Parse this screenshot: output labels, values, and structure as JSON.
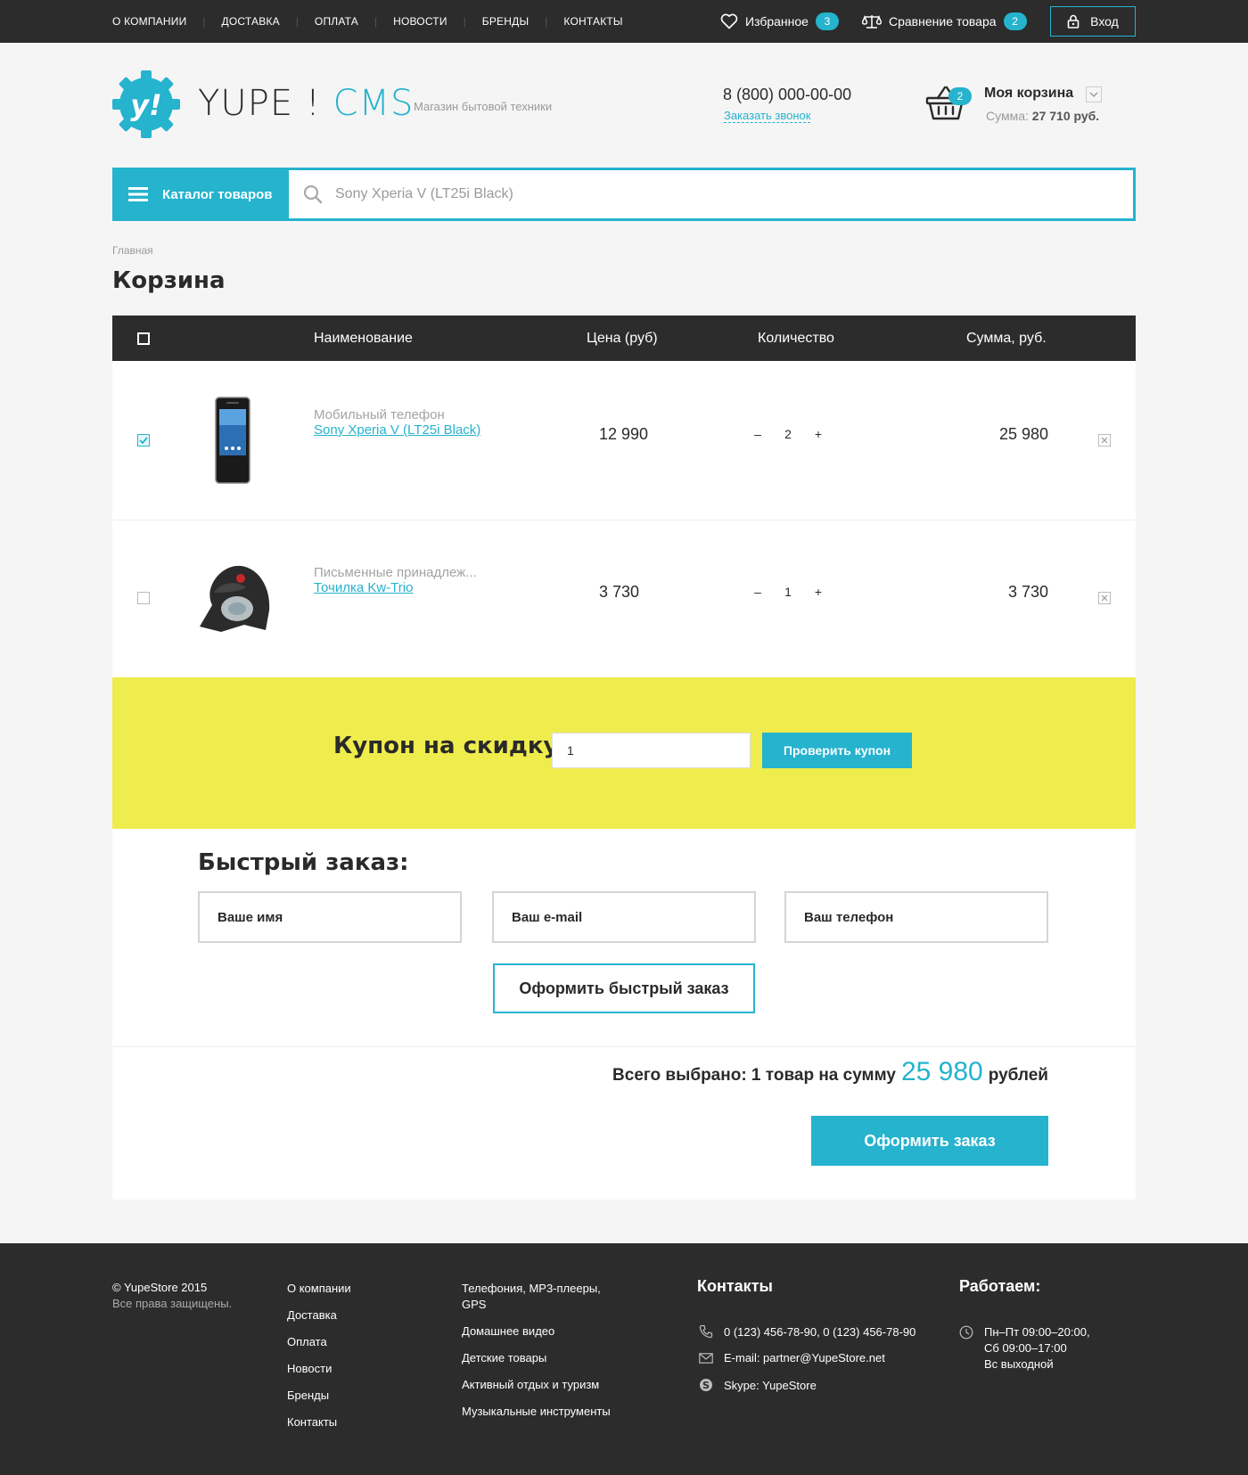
{
  "topnav": {
    "links": [
      "О компании",
      "Доставка",
      "Оплата",
      "Новости",
      "Бренды",
      "Контакты"
    ],
    "favorites_label": "Избранное",
    "favorites_count": "3",
    "compare_label": "Сравнение товара",
    "compare_count": "2",
    "login_label": "Вход"
  },
  "header": {
    "logo_main": "YUPE !",
    "logo_accent": "CMS",
    "tagline": "Магазин бытовой техники",
    "phone": "8 (800) 000-00-00",
    "callback": "Заказать звонок",
    "cart_title": "Моя корзина",
    "cart_count": "2",
    "cart_sum_label": "Сумма:",
    "cart_sum_value": "27 710 руб."
  },
  "search": {
    "catalog_label": "Каталог товаров",
    "placeholder": "Sony Xperia V (LT25i Black)"
  },
  "breadcrumb": "Главная",
  "page_title": "Корзина",
  "table": {
    "headers": {
      "name": "Наименование",
      "price": "Цена (руб)",
      "qty": "Количество",
      "sum": "Сумма, руб."
    },
    "rows": [
      {
        "category": "Мобильный телефон",
        "name": "Sony Xperia V (LT25i Black)",
        "price": "12 990",
        "qty": "2",
        "sum": "25 980",
        "checked": true
      },
      {
        "category": "Письменные принадлеж...",
        "name": "Точилка Kw-Trio",
        "price": "3 730",
        "qty": "1",
        "sum": "3 730",
        "checked": false
      }
    ],
    "minus": "–",
    "plus": "+"
  },
  "coupon": {
    "label": "Купон на скидку:",
    "value": "1",
    "button": "Проверить купон"
  },
  "quick_order": {
    "title": "Быстрый заказ:",
    "name_placeholder": "Ваше имя",
    "email_placeholder": "Ваш e-mail",
    "phone_placeholder": "Ваш телефон",
    "button": "Оформить быстрый заказ"
  },
  "summary": {
    "prefix": "Всего выбрано: 1 товар на сумму",
    "amount": "25 980",
    "suffix": "рублей",
    "order_button": "Оформить заказ"
  },
  "footer": {
    "copyright": "© YupeStore 2015",
    "rights": "Все права защищены.",
    "links1": [
      "О компании",
      "Доставка",
      "Оплата",
      "Новости",
      "Бренды",
      "Контакты"
    ],
    "links2": [
      "Телефония, MP3-плееры, GPS",
      "Домашнее видео",
      "Детские товары",
      "Активный отдых и туризм",
      "Музыкальные инструменты"
    ],
    "contacts_title": "Контакты",
    "phones": "0 (123) 456-78-90, 0 (123) 456-78-90",
    "email": "E-mail: partner@YupeStore.net",
    "skype": "Skype: YupeStore",
    "hours_title": "Работаем:",
    "hours_line1": "Пн–Пт 09:00–20:00,",
    "hours_line2": "Сб 09:00–17:00",
    "hours_line3": "Вс выходной"
  },
  "colors": {
    "accent": "#25b3ce",
    "dark": "#2c2c2c",
    "coupon_bg": "#efec4d"
  }
}
